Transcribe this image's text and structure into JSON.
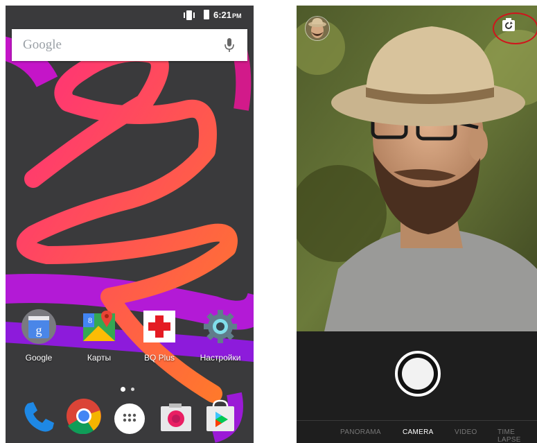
{
  "home": {
    "status": {
      "time": "6:21",
      "ampm": "PM"
    },
    "search": {
      "brand": "Google"
    },
    "apps": [
      {
        "label": "Google",
        "icon": "google-search-icon"
      },
      {
        "label": "Карты",
        "icon": "maps-icon"
      },
      {
        "label": "BQ Plus",
        "icon": "bq-plus-icon"
      },
      {
        "label": "Настройки",
        "icon": "settings-icon"
      }
    ],
    "dock": [
      "phone-icon",
      "chrome-icon",
      "app-drawer-icon",
      "camera-icon",
      "play-store-icon"
    ]
  },
  "camera": {
    "modes": [
      "PANORAMA",
      "CAMERA",
      "VIDEO",
      "TIME LAPSE"
    ],
    "active_mode": "CAMERA",
    "highlight_color": "#d0141c"
  }
}
